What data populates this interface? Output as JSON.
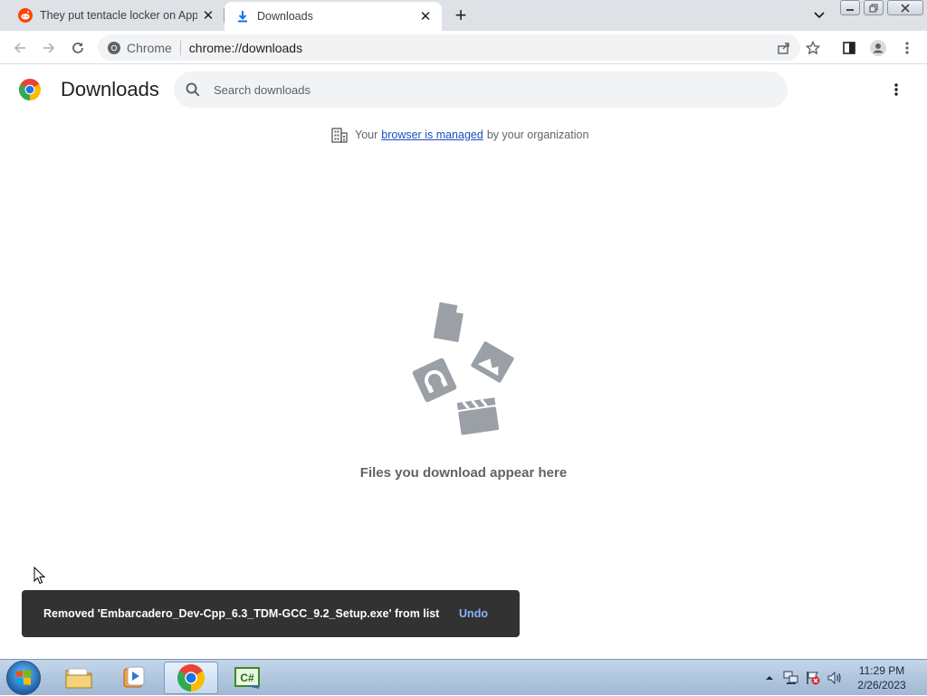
{
  "tabs": [
    {
      "title": "They put tentacle locker on App",
      "active": false,
      "favicon": "reddit-icon"
    },
    {
      "title": "Downloads",
      "active": true,
      "favicon": "download-icon"
    }
  ],
  "omnibox": {
    "site_label": "Chrome",
    "url": "chrome://downloads"
  },
  "page": {
    "title": "Downloads",
    "search_placeholder": "Search downloads",
    "managed": {
      "prefix": "Your",
      "link": "browser is managed",
      "suffix": "by your organization"
    },
    "empty_message": "Files you download appear here"
  },
  "toast": {
    "message": "Removed 'Embarcadero_Dev-Cpp_6.3_TDM-GCC_9.2_Setup.exe' from list",
    "action": "Undo"
  },
  "taskbar": {
    "apps": [
      "file-explorer-icon",
      "media-player-icon",
      "chrome-icon",
      "csharp-ide-icon"
    ],
    "clock": {
      "time": "11:29 PM",
      "date": "2/26/2023"
    }
  },
  "colors": {
    "accent": "#1a73e8",
    "toast_bg": "#323232",
    "undo": "#8ab4f8",
    "tabstrip": "#dee1e6"
  }
}
